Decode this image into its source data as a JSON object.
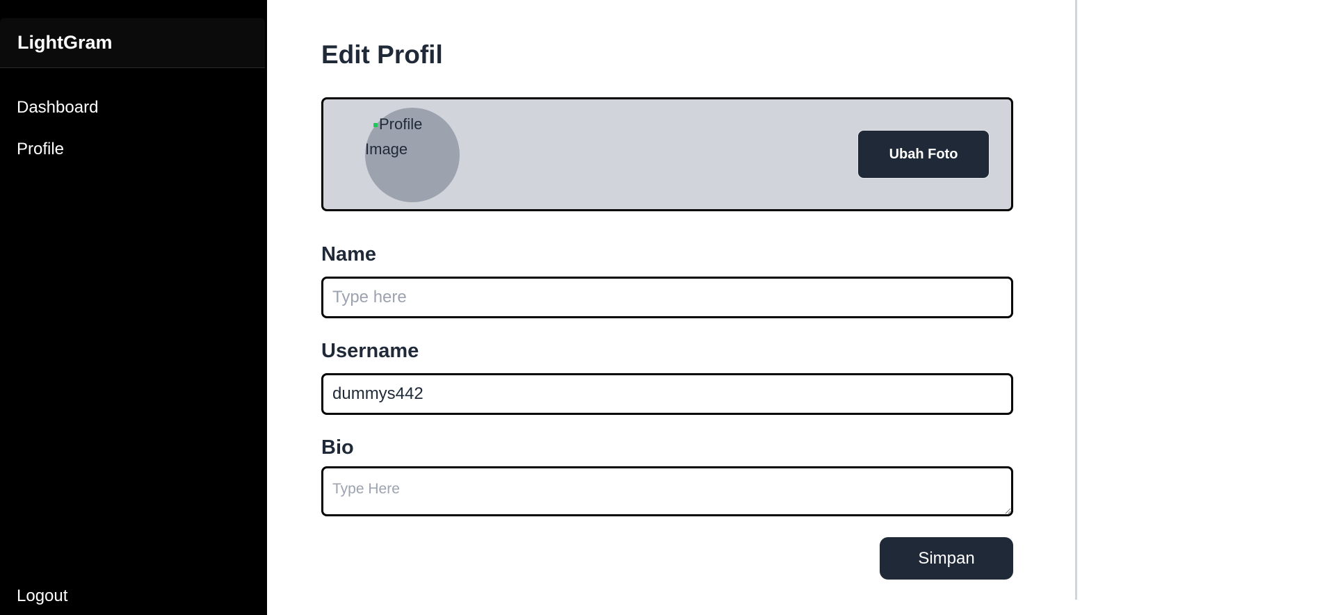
{
  "sidebar": {
    "brand": "LightGram",
    "items": [
      {
        "label": "Dashboard"
      },
      {
        "label": "Profile"
      }
    ],
    "logout_label": "Logout"
  },
  "main": {
    "title": "Edit Profil",
    "photo": {
      "alt_text": "Profile Image",
      "change_button_label": "Ubah Foto"
    },
    "fields": {
      "name": {
        "label": "Name",
        "value": "",
        "placeholder": "Type here"
      },
      "username": {
        "label": "Username",
        "value": "dummys442",
        "placeholder": ""
      },
      "bio": {
        "label": "Bio",
        "value": "",
        "placeholder": "Type Here"
      }
    },
    "save_button_label": "Simpan"
  },
  "colors": {
    "sidebar_bg": "#000000",
    "button_bg": "#1f2937",
    "card_bg": "#d1d5db",
    "avatar_bg": "#9ca3af",
    "text_primary": "#1f2937"
  }
}
